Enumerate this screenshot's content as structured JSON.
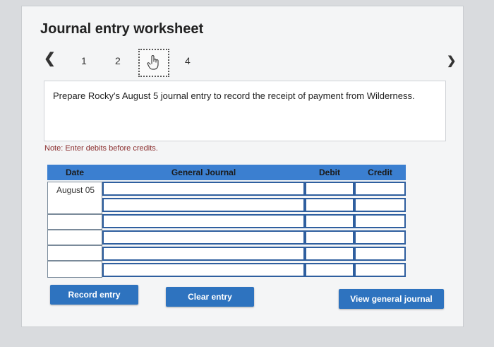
{
  "title": "Journal entry worksheet",
  "pager": {
    "prev_icon": "chevron-left-icon",
    "next_icon": "chevron-right-icon",
    "pages": [
      "1",
      "2",
      "",
      "4"
    ],
    "current_icon": "hand-pointer-icon"
  },
  "prompt": "Prepare Rocky's August 5 journal entry to record the receipt of payment from Wilderness.",
  "note": "Note: Enter debits before credits.",
  "table": {
    "headers": {
      "date": "Date",
      "journal": "General Journal",
      "debit": "Debit",
      "credit": "Credit"
    },
    "rows": [
      {
        "date": "August 05"
      },
      {
        "date": ""
      },
      {
        "date": ""
      },
      {
        "date": ""
      },
      {
        "date": ""
      },
      {
        "date": ""
      }
    ]
  },
  "buttons": {
    "record": "Record entry",
    "clear": "Clear entry",
    "view": "View general journal"
  },
  "colors": {
    "accent": "#2e73bf",
    "header": "#3b7fd0",
    "note": "#8a2d2d"
  }
}
